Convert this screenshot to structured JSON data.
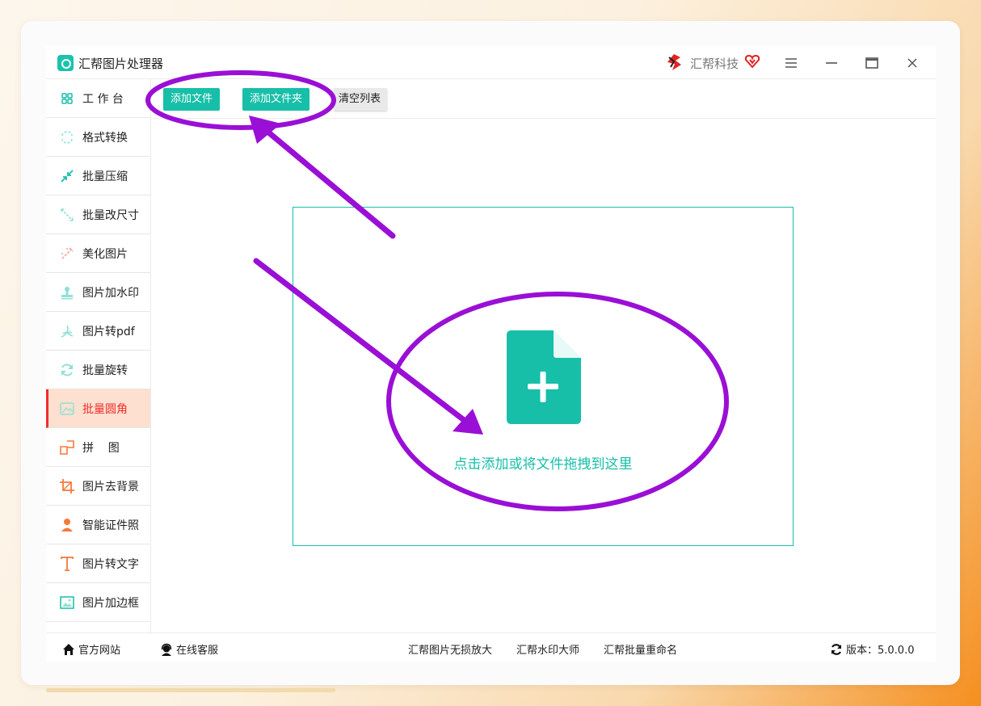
{
  "app": {
    "title": "汇帮图片处理器",
    "brand": "汇帮科技"
  },
  "colors": {
    "accent": "#17bfa9",
    "active": "#ef2d2d",
    "annotation": "#9a0fd6"
  },
  "sidebar": {
    "items": [
      {
        "label": "工 作 台",
        "icon": "grid-icon"
      },
      {
        "label": "格式转换",
        "icon": "convert-icon"
      },
      {
        "label": "批量压缩",
        "icon": "compress-icon"
      },
      {
        "label": "批量改尺寸",
        "icon": "resize-icon"
      },
      {
        "label": "美化图片",
        "icon": "beautify-icon"
      },
      {
        "label": "图片加水印",
        "icon": "stamp-icon"
      },
      {
        "label": "图片转pdf",
        "icon": "pdf-icon"
      },
      {
        "label": "批量旋转",
        "icon": "rotate-icon"
      },
      {
        "label": "批量圆角",
        "icon": "round-corner-icon",
        "active": true
      },
      {
        "label": "拼    图",
        "icon": "puzzle-icon"
      },
      {
        "label": "图片去背景",
        "icon": "crop-icon"
      },
      {
        "label": "智能证件照",
        "icon": "person-icon"
      },
      {
        "label": "图片转文字",
        "icon": "text-icon"
      },
      {
        "label": "图片加边框",
        "icon": "frame-icon"
      }
    ]
  },
  "toolbar": {
    "add_file": "添加文件",
    "add_folder": "添加文件夹",
    "clear_list": "清空列表"
  },
  "dropzone": {
    "text": "点击添加或将文件拖拽到这里"
  },
  "footer": {
    "website": "官方网站",
    "support": "在线客服",
    "link1": "汇帮图片无损放大",
    "link2": "汇帮水印大师",
    "link3": "汇帮批量重命名",
    "version": "版本：5.0.0.0"
  }
}
